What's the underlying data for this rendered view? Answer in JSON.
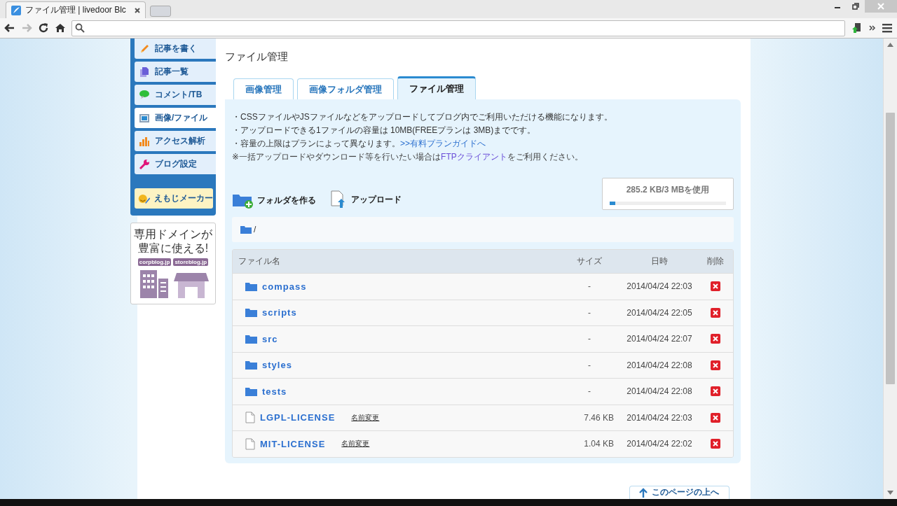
{
  "browser": {
    "tab_title": "ファイル管理 | livedoor Blc"
  },
  "sidebar": {
    "items": [
      {
        "label": "記事を書く",
        "selected": false
      },
      {
        "label": "記事一覧",
        "selected": false
      },
      {
        "label": "コメント/TB",
        "selected": false
      },
      {
        "label": "画像/ファイル",
        "selected": true
      },
      {
        "label": "アクセス解析",
        "selected": false
      },
      {
        "label": "ブログ設定",
        "selected": false
      }
    ],
    "extra": {
      "label": "えもじメーカー"
    }
  },
  "ad": {
    "headline": [
      "専用ドメインが",
      "豊富に使える!"
    ],
    "tags": [
      "corpblog.jp",
      "storeblog.jp"
    ]
  },
  "page_title": "ファイル管理",
  "tabs": [
    {
      "label": "画像管理",
      "selected": false
    },
    {
      "label": "画像フォルダ管理",
      "selected": false
    },
    {
      "label": "ファイル管理",
      "selected": true
    }
  ],
  "notes": [
    {
      "kind": "plain",
      "text": "・CSSファイルやJSファイルなどをアップロードしてブログ内でご利用いただける機能になります。"
    },
    {
      "kind": "plain",
      "text": "・アップロードできる1ファイルの容量は 10MB(FREEプランは 3MB)までです。"
    },
    {
      "kind": "plain",
      "text": "・容量の上限はプランによって異なります。",
      "link": ">>有料プランガイドへ"
    },
    {
      "kind": "small",
      "text": "※一括アップロードやダウンロード等を行いたい場合は",
      "link": "FTPクライアント",
      "after": "をご利用ください。"
    }
  ],
  "actions": [
    {
      "kind": "folder",
      "label": "フォルダを作る"
    },
    {
      "kind": "upload",
      "label": "アップロード"
    }
  ],
  "usage": {
    "text": "285.2 KB/3 MBを使用",
    "level": 0.05
  },
  "breadcrumb": "/",
  "table": {
    "columns": [
      "ファイル名",
      "サイズ",
      "日時",
      "削除"
    ],
    "rows": [
      {
        "kind": "folder",
        "name": "compass",
        "size": "-",
        "date": "2014/04/24 22:03"
      },
      {
        "kind": "folder",
        "name": "scripts",
        "size": "-",
        "date": "2014/04/24 22:05"
      },
      {
        "kind": "folder",
        "name": "src",
        "size": "-",
        "date": "2014/04/24 22:07"
      },
      {
        "kind": "folder",
        "name": "styles",
        "size": "-",
        "date": "2014/04/24 22:08"
      },
      {
        "kind": "folder",
        "name": "tests",
        "size": "-",
        "date": "2014/04/24 22:08"
      },
      {
        "kind": "file",
        "name": "LGPL-LICENSE",
        "rename": "名前変更",
        "size": "7.46 KB",
        "date": "2014/04/24 22:03"
      },
      {
        "kind": "file",
        "name": "MIT-LICENSE",
        "rename": "名前変更",
        "size": "1.04 KB",
        "date": "2014/04/24 22:02"
      }
    ]
  },
  "back_to_top": "このページの上へ"
}
